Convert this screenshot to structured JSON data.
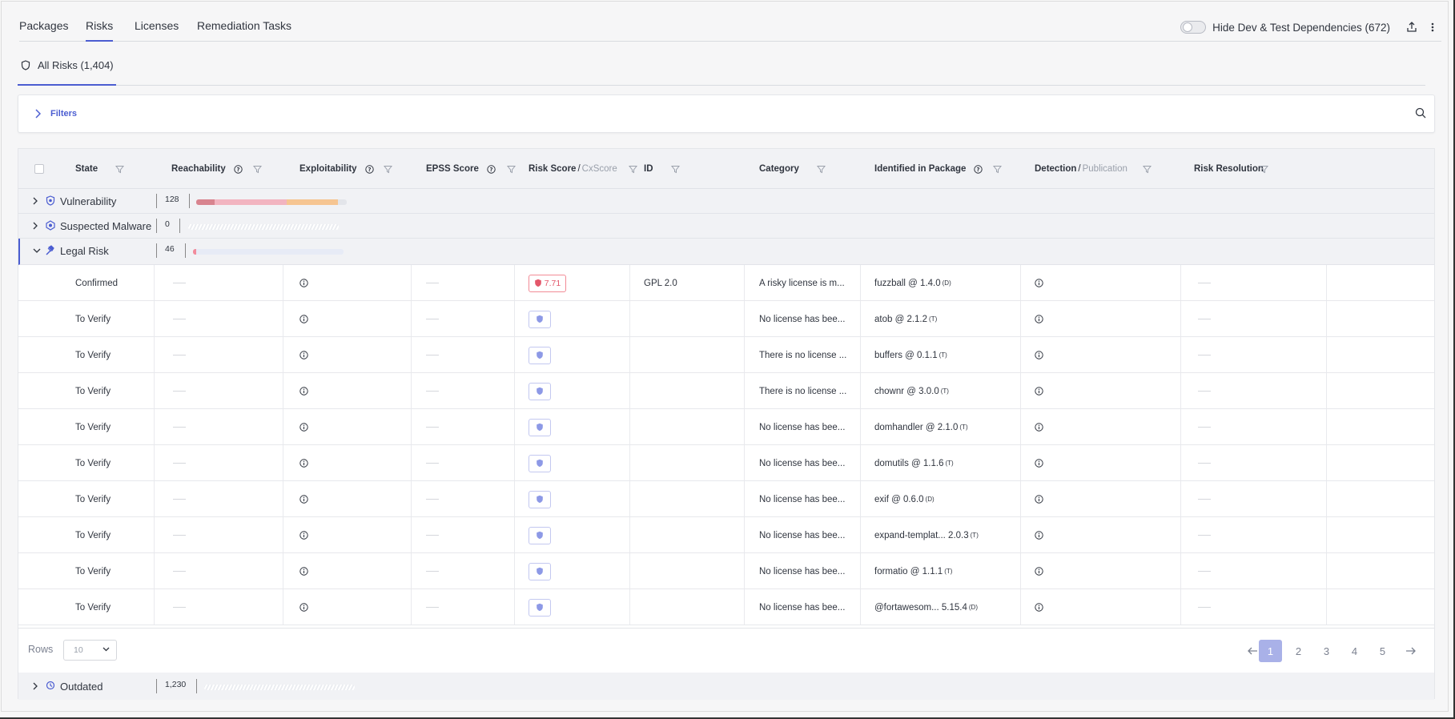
{
  "nav": {
    "tabs": [
      {
        "label": "Packages"
      },
      {
        "label": "Risks"
      },
      {
        "label": "Licenses"
      },
      {
        "label": "Remediation Tasks"
      }
    ],
    "active_tab": "Risks",
    "hide_dev_label": "Hide Dev & Test Dependencies (672)"
  },
  "subtab": {
    "label": "All Risks (1,404)"
  },
  "filters": {
    "label": "Filters"
  },
  "table": {
    "headers": {
      "state": "State",
      "reachability": "Reachability",
      "exploitability": "Exploitability",
      "epss": "EPSS Score",
      "risk_score": "Risk Score",
      "cx_score": "CxScore",
      "id": "ID",
      "category": "Category",
      "package": "Identified in Package",
      "detection": "Detection",
      "publication": "Publication",
      "resolution": "Risk Resolution",
      "slash": "/"
    },
    "groups": {
      "vulnerability": {
        "label": "Vulnerability",
        "count": "128",
        "bar": [
          0.12,
          0.48,
          0.34,
          0.06
        ]
      },
      "malware": {
        "label": "Suspected Malware",
        "count": "0"
      },
      "legal": {
        "label": "Legal Risk",
        "count": "46"
      },
      "outdated": {
        "label": "Outdated",
        "count": "1,230"
      }
    },
    "rows": [
      {
        "state": "Confirmed",
        "score": "7.71",
        "id": "GPL 2.0",
        "category": "A risky license is m...",
        "package": "fuzzball @ 1.4.0",
        "tag": "(D)"
      },
      {
        "state": "To Verify",
        "score": "",
        "id": "",
        "category": "No license has bee...",
        "package": "atob @ 2.1.2",
        "tag": "(T)"
      },
      {
        "state": "To Verify",
        "score": "",
        "id": "",
        "category": "There is no license ...",
        "package": "buffers @ 0.1.1",
        "tag": "(T)"
      },
      {
        "state": "To Verify",
        "score": "",
        "id": "",
        "category": "There is no license ...",
        "package": "chownr @ 3.0.0",
        "tag": "(T)"
      },
      {
        "state": "To Verify",
        "score": "",
        "id": "",
        "category": "No license has bee...",
        "package": "domhandler @ 2.1.0",
        "tag": "(T)"
      },
      {
        "state": "To Verify",
        "score": "",
        "id": "",
        "category": "No license has bee...",
        "package": "domutils @ 1.1.6",
        "tag": "(T)"
      },
      {
        "state": "To Verify",
        "score": "",
        "id": "",
        "category": "No license has bee...",
        "package": "exif @ 0.6.0",
        "tag": "(D)"
      },
      {
        "state": "To Verify",
        "score": "",
        "id": "",
        "category": "No license has bee...",
        "package": "expand-templat... 2.0.3",
        "tag": "(T)"
      },
      {
        "state": "To Verify",
        "score": "",
        "id": "",
        "category": "No license has bee...",
        "package": "formatio @ 1.1.1",
        "tag": "(T)"
      },
      {
        "state": "To Verify",
        "score": "",
        "id": "",
        "category": "No license has bee...",
        "package": "@fortawesom... 5.15.4",
        "tag": "(D)"
      }
    ]
  },
  "pager": {
    "rows_label": "Rows",
    "rows_value": "10",
    "pages": [
      "1",
      "2",
      "3",
      "4",
      "5"
    ],
    "active_page": "1"
  },
  "colors": {
    "accent": "#4b5dd1",
    "critical": "#d8848f",
    "high": "#f2b4c0",
    "medium": "#f6c592",
    "low": "#e3e5ea",
    "legal_bar": "#f28b9b"
  }
}
